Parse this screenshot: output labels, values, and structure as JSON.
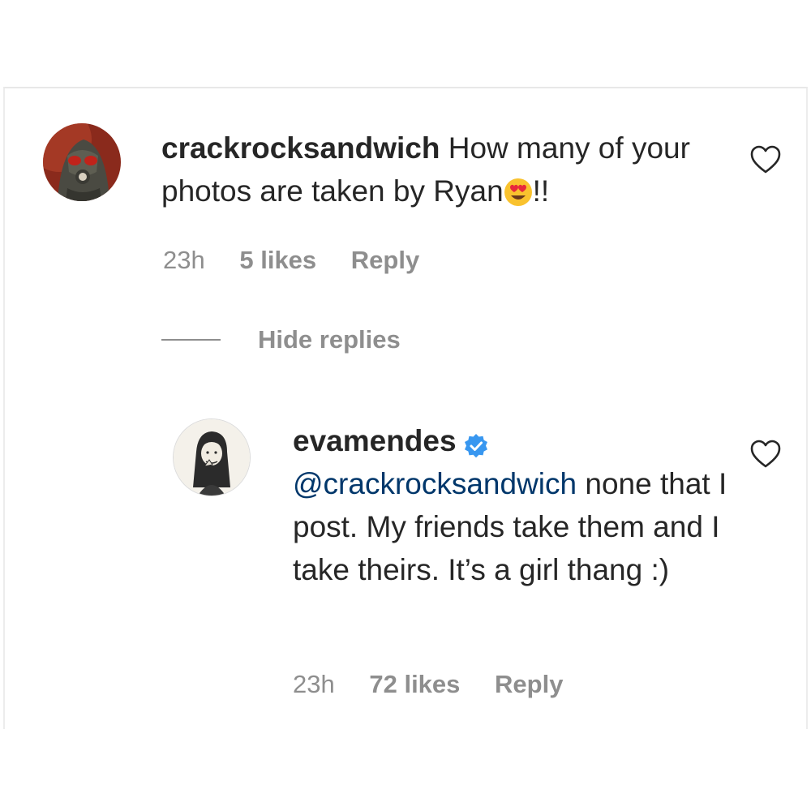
{
  "comment": {
    "username": "crackrocksandwich",
    "text_part1": "How many of your photos are taken by Ryan",
    "emoji": "heart-eyes-emoji",
    "text_part2": "!!",
    "time": "23h",
    "likes": "5 likes",
    "reply_label": "Reply"
  },
  "thread": {
    "hide_replies_label": "Hide replies"
  },
  "reply": {
    "username": "evamendes",
    "verified": true,
    "mention": "@crackrocksandwich",
    "text": " none that I post. My friends take them and I take theirs. It’s a girl thang :)",
    "time": "23h",
    "likes": "72 likes",
    "reply_label": "Reply"
  },
  "colors": {
    "text": "#262626",
    "meta": "#8e8e8e",
    "mention": "#00376b",
    "verified": "#3897f0"
  }
}
